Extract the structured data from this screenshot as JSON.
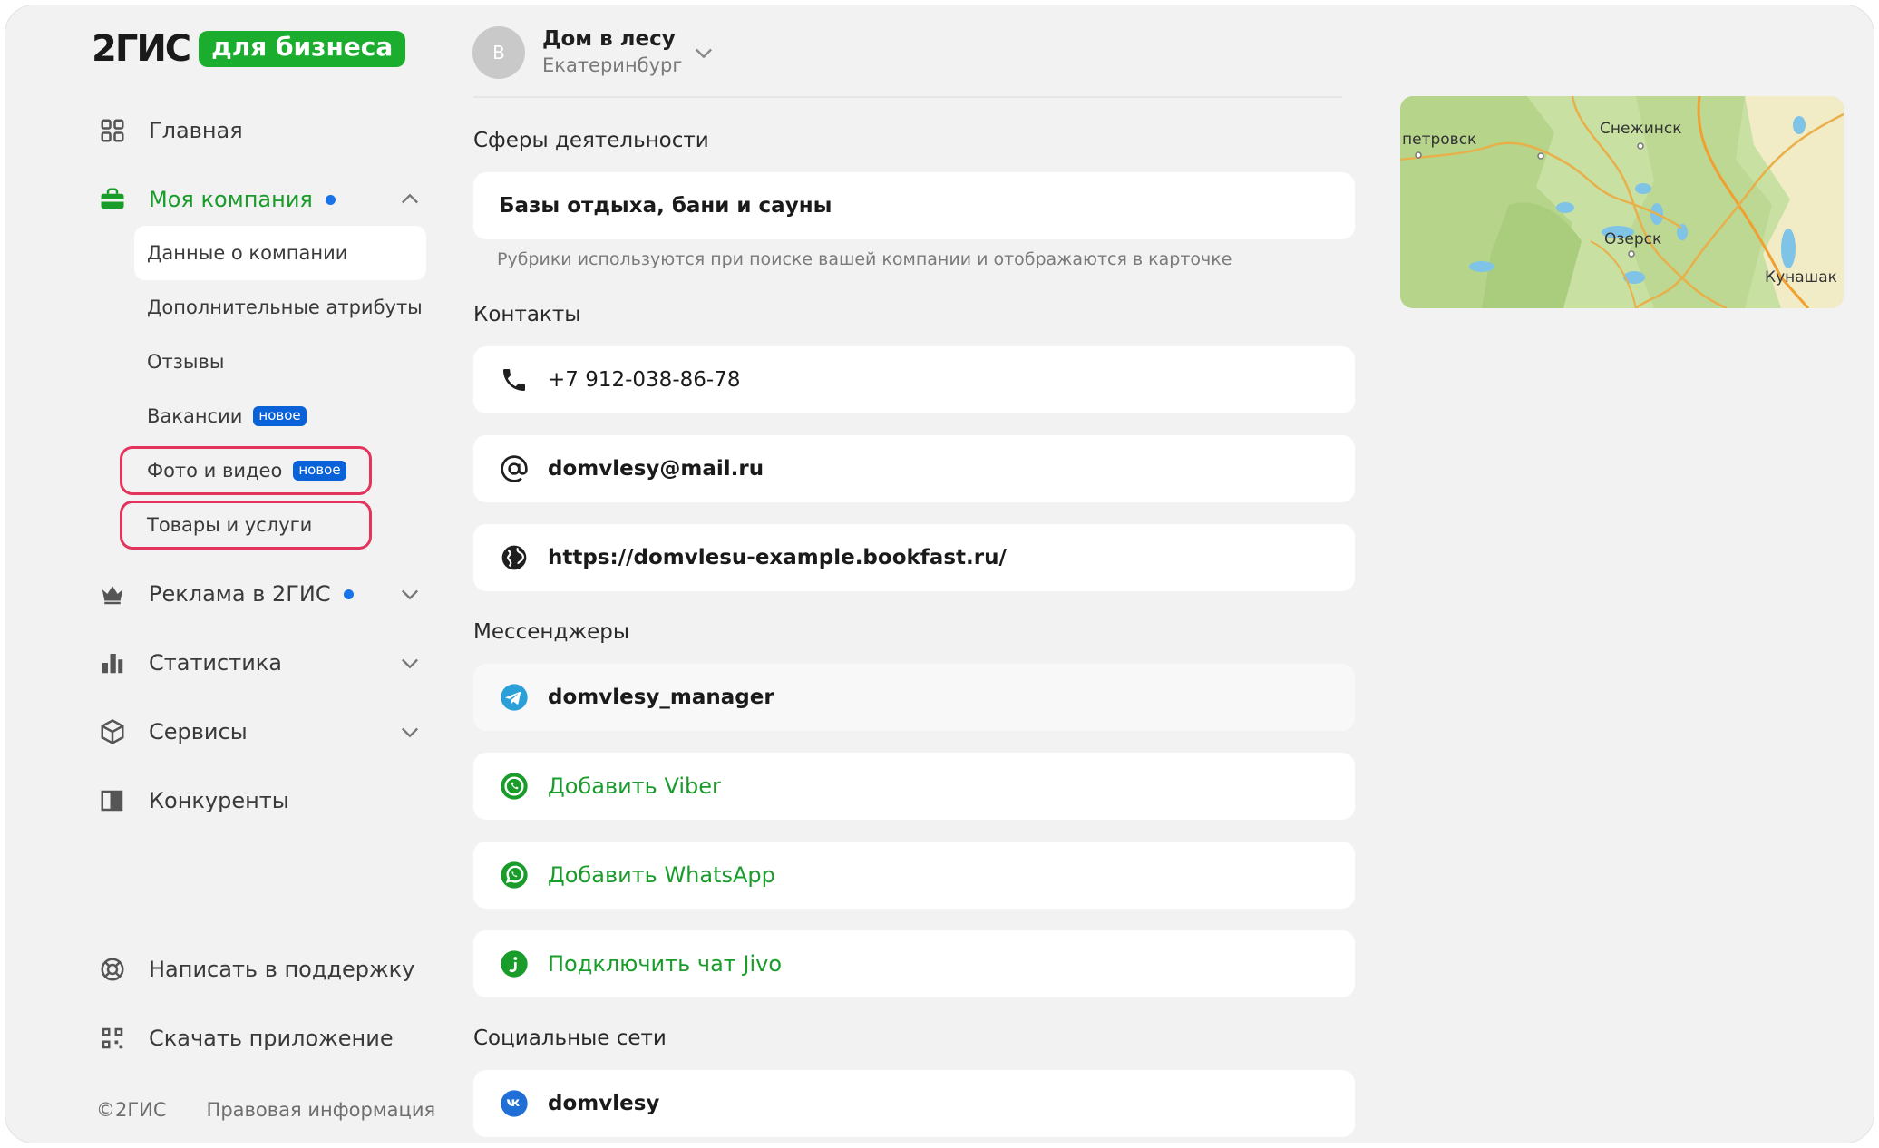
{
  "logo": {
    "brand": "2ГИС",
    "badge": "для бизнеса"
  },
  "sidebar": {
    "nav": [
      {
        "label": "Главная",
        "icon": "dashboard-icon"
      },
      {
        "label": "Моя компания",
        "icon": "briefcase-icon"
      },
      {
        "label": "Реклама в 2ГИС",
        "icon": "crown-icon"
      },
      {
        "label": "Статистика",
        "icon": "bar-chart-icon"
      },
      {
        "label": "Сервисы",
        "icon": "cube-icon"
      },
      {
        "label": "Конкуренты",
        "icon": "compare-icon"
      }
    ],
    "submenu": [
      {
        "label": "Данные о компании"
      },
      {
        "label": "Дополнительные атрибуты"
      },
      {
        "label": "Отзывы"
      },
      {
        "label": "Вакансии",
        "badge": "новое"
      },
      {
        "label": "Фото и видео",
        "badge": "новое"
      },
      {
        "label": "Товары и услуги"
      }
    ],
    "bottom": [
      {
        "label": "Написать в поддержку",
        "icon": "lifebuoy-icon"
      },
      {
        "label": "Скачать приложение",
        "icon": "qr-code-icon"
      }
    ],
    "footer": {
      "copyright": "©2ГИС",
      "legal": "Правовая информация"
    },
    "colors": {
      "active": "#1a9c2b",
      "dot": "#1a73e8",
      "highlight": "#e2345c",
      "badge": "#0a62d9"
    }
  },
  "header": {
    "avatar_letter": "В",
    "company_name": "Дом в лесу",
    "city": "Екатеринбург"
  },
  "main": {
    "activity": {
      "title": "Сферы деятельности",
      "value": "Базы отдыха, бани и сауны",
      "hint": "Рубрики используются при поиске вашей компании и отображаются в карточке"
    },
    "contacts": {
      "title": "Контакты",
      "phone": "+7 912-038-86-78",
      "email": "domvlesy@mail.ru",
      "website": "https://domvlesu-example.bookfast.ru/"
    },
    "messengers": {
      "title": "Мессенджеры",
      "telegram": "domvlesy_manager",
      "viber": "Добавить Viber",
      "whatsapp": "Добавить WhatsApp",
      "jivo": "Подключить чат Jivo"
    },
    "social": {
      "title": "Социальные сети",
      "vk": "domvlesy"
    }
  },
  "map": {
    "labels": [
      "петровск",
      "Снежинск",
      "Озерск",
      "Кунашак"
    ]
  }
}
